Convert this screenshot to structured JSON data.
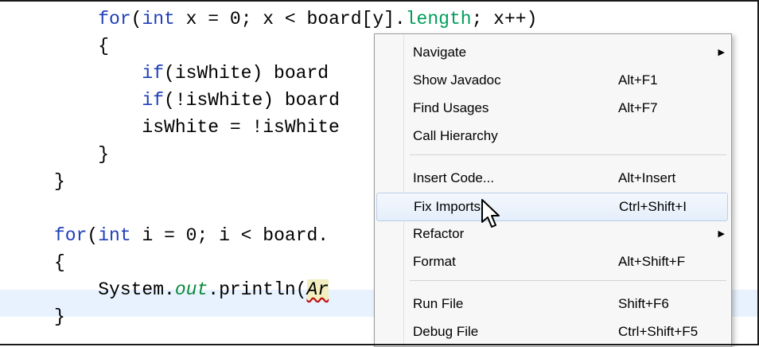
{
  "code_lines": [
    {
      "indent": "    ",
      "parts": [
        {
          "t": "for",
          "c": "kw"
        },
        {
          "t": "(",
          "c": ""
        },
        {
          "t": "int",
          "c": "kw"
        },
        {
          "t": " x = 0; x < board[y].",
          "c": ""
        },
        {
          "t": "length",
          "c": "m"
        },
        {
          "t": "; x++)",
          "c": ""
        }
      ]
    },
    {
      "indent": "    ",
      "parts": [
        {
          "t": "{",
          "c": ""
        }
      ]
    },
    {
      "indent": "        ",
      "parts": [
        {
          "t": "if",
          "c": "kw"
        },
        {
          "t": "(isWhite) board",
          "c": ""
        }
      ]
    },
    {
      "indent": "        ",
      "parts": [
        {
          "t": "if",
          "c": "kw"
        },
        {
          "t": "(!isWhite) board",
          "c": ""
        }
      ]
    },
    {
      "indent": "        ",
      "parts": [
        {
          "t": "isWhite = !isWhite",
          "c": ""
        }
      ]
    },
    {
      "indent": "    ",
      "parts": [
        {
          "t": "}",
          "c": ""
        }
      ]
    },
    {
      "indent": "",
      "parts": [
        {
          "t": "}",
          "c": ""
        }
      ]
    },
    {
      "indent": "",
      "parts": []
    },
    {
      "indent": "",
      "parts": [
        {
          "t": "for",
          "c": "kw"
        },
        {
          "t": "(",
          "c": ""
        },
        {
          "t": "int",
          "c": "kw"
        },
        {
          "t": " i = 0; i < board.",
          "c": ""
        }
      ]
    },
    {
      "indent": "",
      "parts": [
        {
          "t": "{",
          "c": ""
        }
      ]
    },
    {
      "indent": "    ",
      "parts": [
        {
          "t": "System.",
          "c": ""
        },
        {
          "t": "out",
          "c": "fld"
        },
        {
          "t": ".println(",
          "c": ""
        },
        {
          "t": "Ar",
          "c": "arg"
        }
      ]
    },
    {
      "indent": "",
      "parts": [
        {
          "t": "}",
          "c": ""
        }
      ]
    }
  ],
  "menu": {
    "items": [
      {
        "label": "Navigate",
        "shortcut": "",
        "submenu": true,
        "name": "menu-item-navigate"
      },
      {
        "label": "Show Javadoc",
        "shortcut": "Alt+F1",
        "submenu": false,
        "name": "menu-item-show-javadoc"
      },
      {
        "label": "Find Usages",
        "shortcut": "Alt+F7",
        "submenu": false,
        "name": "menu-item-find-usages"
      },
      {
        "label": "Call Hierarchy",
        "shortcut": "",
        "submenu": false,
        "name": "menu-item-call-hierarchy"
      },
      {
        "label": "Insert Code...",
        "shortcut": "Alt+Insert",
        "submenu": false,
        "name": "menu-item-insert-code"
      },
      {
        "label": "Fix Imports",
        "shortcut": "Ctrl+Shift+I",
        "submenu": false,
        "name": "menu-item-fix-imports"
      },
      {
        "label": "Refactor",
        "shortcut": "",
        "submenu": true,
        "name": "menu-item-refactor"
      },
      {
        "label": "Format",
        "shortcut": "Alt+Shift+F",
        "submenu": false,
        "name": "menu-item-format"
      },
      {
        "label": "Run File",
        "shortcut": "Shift+F6",
        "submenu": false,
        "name": "menu-item-run-file"
      },
      {
        "label": "Debug File",
        "shortcut": "Ctrl+Shift+F5",
        "submenu": false,
        "name": "menu-item-debug-file"
      }
    ],
    "hovered_label": "Fix Imports",
    "submenu_arrow": "▶"
  },
  "colors": {
    "keyword": "#1f3fb8",
    "method": "#009e5c",
    "current_line": "#e8f2fe",
    "menu_hover": "#e4eefa"
  },
  "icons": [
    "mouse-pointer-icon",
    "submenu-arrow-icon"
  ]
}
